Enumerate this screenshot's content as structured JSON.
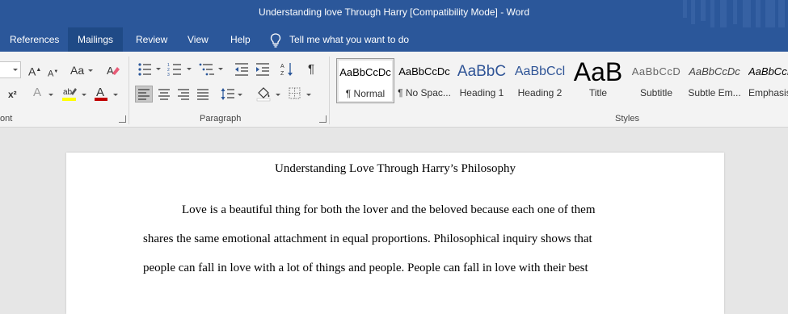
{
  "window": {
    "title": "Understanding love Through Harry [Compatibility Mode]  -  Word"
  },
  "tabs": [
    {
      "label": "References"
    },
    {
      "label": "Mailings"
    },
    {
      "label": "Review"
    },
    {
      "label": "View"
    },
    {
      "label": "Help"
    }
  ],
  "active_tab": "Mailings",
  "tell_me": {
    "label": "Tell me what you want to do",
    "icon": "lightbulb-icon"
  },
  "ribbon": {
    "groups": [
      {
        "label": "ont"
      },
      {
        "label": "Paragraph"
      },
      {
        "label": "Styles"
      }
    ],
    "font": {
      "grow_label": "A",
      "shrink_label": "A",
      "case_label": "Aa",
      "superscript_label": "x²",
      "text_effects_label": "A",
      "font_color_label": "A",
      "font_color": "#c00000",
      "highlight_color": "#ffff00"
    },
    "styles": [
      {
        "sample": "AaBbCcDc",
        "name": "¶ Normal"
      },
      {
        "sample": "AaBbCcDc",
        "name": "¶ No Spac..."
      },
      {
        "sample": "AaBbC",
        "name": "Heading 1"
      },
      {
        "sample": "AaBbCcl",
        "name": "Heading 2"
      },
      {
        "sample": "AaB",
        "name": "Title"
      },
      {
        "sample": "AaBbCcD",
        "name": "Subtitle"
      },
      {
        "sample": "AaBbCcDc",
        "name": "Subtle Em..."
      },
      {
        "sample": "AaBbCcI",
        "name": "Emphasis"
      }
    ]
  },
  "document": {
    "title": "Understanding Love Through Harry’s Philosophy",
    "lines": [
      "Love is a beautiful thing for both the lover and the beloved because each one of them",
      "shares the same emotional attachment in equal proportions. Philosophical inquiry shows that",
      "people can fall in love with a lot of things and people. People can fall in love with their best"
    ]
  },
  "colors": {
    "title_bar": "#2b579a",
    "active_tab": "#1f4a86",
    "ribbon": "#f3f3f3",
    "canvas": "#e6e6e6",
    "heading_blue": "#2f5496"
  }
}
